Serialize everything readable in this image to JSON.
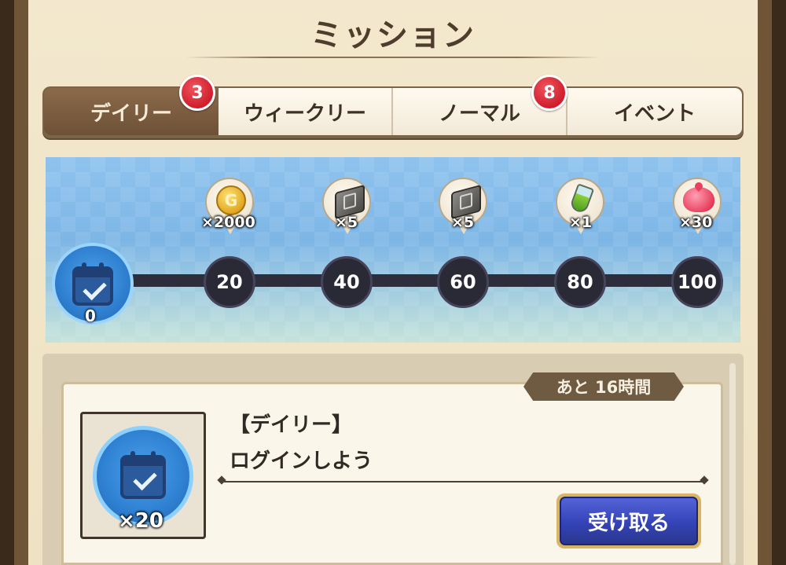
{
  "window": {
    "title": "ミッション"
  },
  "tabs": [
    {
      "label": "デイリー",
      "badge": "3",
      "active": true
    },
    {
      "label": "ウィークリー",
      "badge": ""
    },
    {
      "label": "ノーマル",
      "badge": "8"
    },
    {
      "label": "イベント",
      "badge": ""
    }
  ],
  "progress": {
    "current": "0",
    "current_icon": "calendar-check-icon",
    "milestones": [
      {
        "points": "20",
        "reward_icon": "gold-coin-icon",
        "reward_qty": "×2000"
      },
      {
        "points": "40",
        "reward_icon": "sword-slab-icon",
        "reward_qty": "×5"
      },
      {
        "points": "60",
        "reward_icon": "shield-slab-icon",
        "reward_qty": "×5"
      },
      {
        "points": "80",
        "reward_icon": "potion-icon",
        "reward_qty": "×1"
      },
      {
        "points": "100",
        "reward_icon": "slime-icon",
        "reward_qty": "×30"
      }
    ]
  },
  "mission": {
    "time_left": "あと 16時間",
    "category": "【デイリー】",
    "name": "ログインしよう",
    "reward_icon": "calendar-check-icon",
    "reward_qty": "×20",
    "claim_label": "受け取る"
  },
  "colors": {
    "accent_blue": "#3443b6",
    "badge_red": "#cf1d2c",
    "tab_active": "#7a5b3e"
  }
}
